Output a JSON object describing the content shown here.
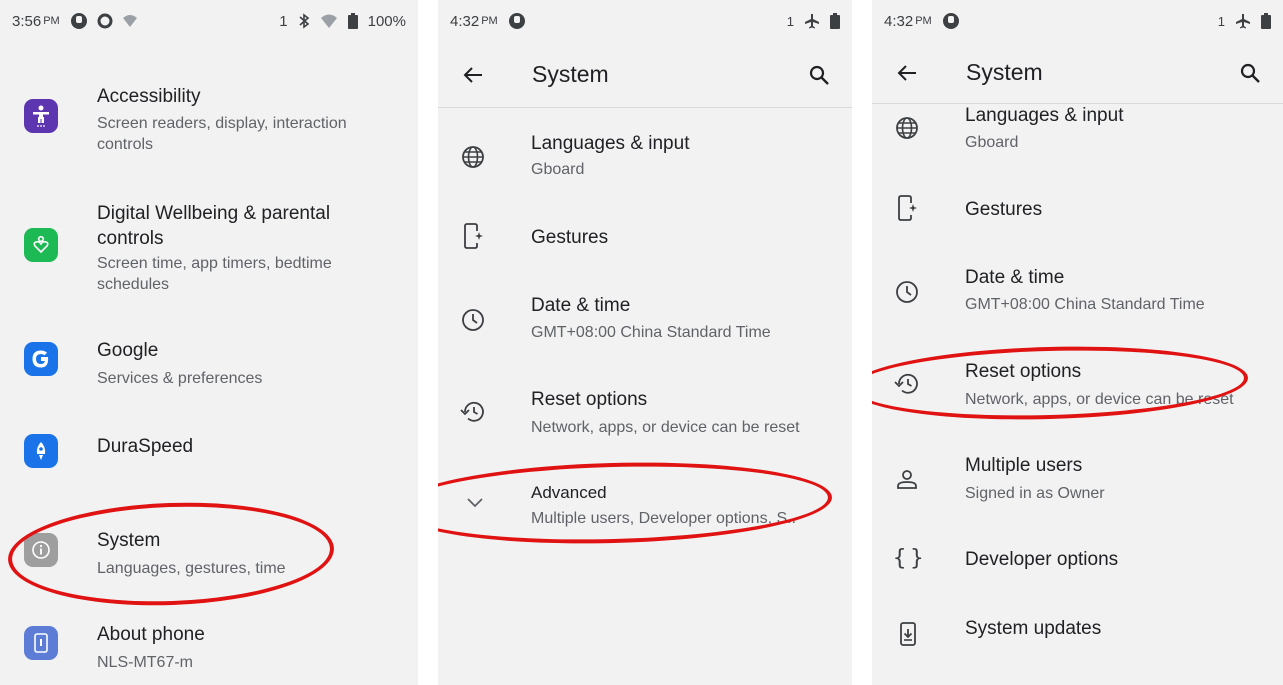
{
  "panel1": {
    "status": {
      "time": "3:56",
      "ampm": "PM",
      "sim": "1",
      "battery": "100%"
    },
    "items": [
      {
        "title": "Accessibility",
        "subtitle": "Screen readers, display, interaction controls",
        "icon": "accessibility-icon",
        "color": "#5e35b1"
      },
      {
        "title": "Digital Wellbeing & parental controls",
        "subtitle": "Screen time, app timers, bedtime schedules",
        "icon": "wellbeing-icon",
        "color": "#1db954"
      },
      {
        "title": "Google",
        "subtitle": "Services & preferences",
        "icon": "google-icon",
        "color": "#1a73e8"
      },
      {
        "title": "DuraSpeed",
        "subtitle": "",
        "icon": "rocket-icon",
        "color": "#1a73e8"
      },
      {
        "title": "System",
        "subtitle": "Languages, gestures, time",
        "icon": "info-icon",
        "color": "#9e9e9e"
      },
      {
        "title": "About phone",
        "subtitle": "NLS-MT67-m",
        "icon": "phone-icon",
        "color": "#5c7cd6"
      }
    ]
  },
  "panel2": {
    "status": {
      "time": "4:32",
      "ampm": "PM",
      "sim": "1"
    },
    "title": "System",
    "items": [
      {
        "title": "Languages & input",
        "subtitle": "Gboard",
        "icon": "globe-icon"
      },
      {
        "title": "Gestures",
        "subtitle": "",
        "icon": "gestures-icon"
      },
      {
        "title": "Date & time",
        "subtitle": "GMT+08:00 China Standard Time",
        "icon": "clock-icon"
      },
      {
        "title": "Reset options",
        "subtitle": "Network, apps, or device can be reset",
        "icon": "reset-icon"
      },
      {
        "title": "Advanced",
        "subtitle": "Multiple users, Developer options, S..",
        "icon": "chevron-down-icon"
      }
    ]
  },
  "panel3": {
    "status": {
      "time": "4:32",
      "ampm": "PM",
      "sim": "1"
    },
    "title": "System",
    "items": [
      {
        "title": "Languages & input",
        "subtitle": "Gboard",
        "icon": "globe-icon"
      },
      {
        "title": "Gestures",
        "subtitle": "",
        "icon": "gestures-icon"
      },
      {
        "title": "Date & time",
        "subtitle": "GMT+08:00 China Standard Time",
        "icon": "clock-icon"
      },
      {
        "title": "Reset options",
        "subtitle": "Network, apps, or device can be reset",
        "icon": "reset-icon"
      },
      {
        "title": "Multiple users",
        "subtitle": "Signed in as Owner",
        "icon": "person-icon"
      },
      {
        "title": "Developer options",
        "subtitle": "",
        "icon": "braces-icon"
      },
      {
        "title": "System updates",
        "subtitle": "",
        "icon": "system-update-icon"
      }
    ]
  },
  "colors": {
    "highlight": "#e01212",
    "panel_bg": "#f2f2f2",
    "text": "#202124",
    "subtext": "#5f6368"
  }
}
